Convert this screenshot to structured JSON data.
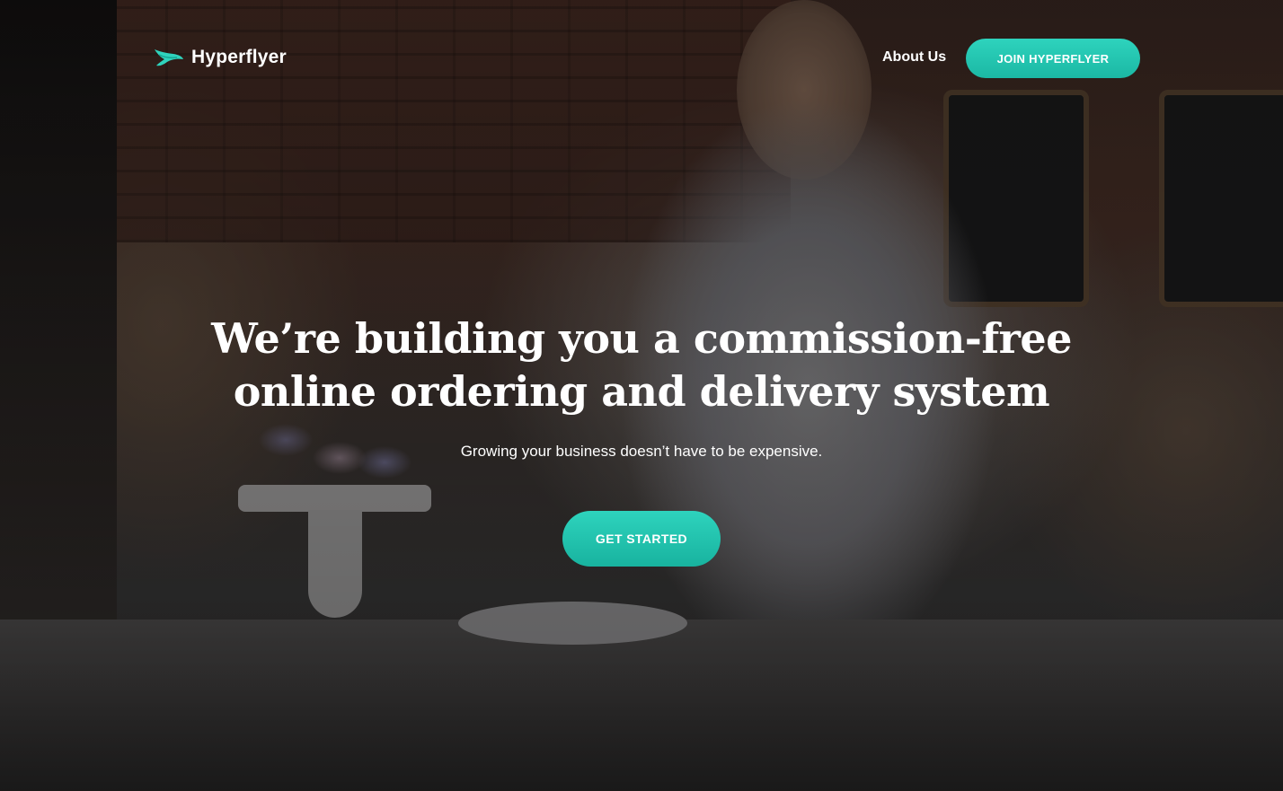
{
  "header": {
    "brand": "Hyperflyer",
    "nav": {
      "about_label": "About Us"
    },
    "cta_label": "JOIN HYPERFLYER"
  },
  "hero": {
    "headline": "We’re building you a commission-free online ordering and delivery system",
    "subheadline": "Growing your business doesn’t have to be expensive.",
    "cta_label": "GET STARTED"
  },
  "icons": {
    "logo": "hyperflyer-wing-logo"
  },
  "colors": {
    "accent": "#20c3ad",
    "text": "#ffffff"
  }
}
